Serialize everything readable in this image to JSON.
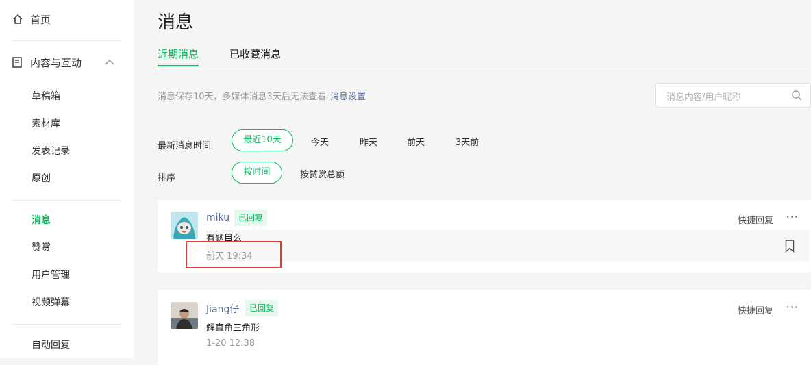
{
  "sidebar": {
    "home": "首页",
    "group": "内容与互动",
    "items": [
      "草稿箱",
      "素材库",
      "发表记录",
      "原创"
    ],
    "items2": [
      "消息",
      "赞赏",
      "用户管理",
      "视频弹幕"
    ],
    "items3": [
      "自动回复"
    ]
  },
  "main": {
    "title": "消息",
    "tabs": [
      "近期消息",
      "已收藏消息"
    ],
    "notice": "消息保存10天，多媒体消息3天后无法查看",
    "notice_link": "消息设置",
    "search_placeholder": "消息内容/用户昵称",
    "time_filter": {
      "label": "最新消息时间",
      "options": [
        "最近10天",
        "今天",
        "昨天",
        "前天",
        "3天前"
      ],
      "selected": "最近10天"
    },
    "sort_filter": {
      "label": "排序",
      "options": [
        "按时间",
        "按赞赏总额"
      ],
      "selected": "按时间"
    },
    "messages": [
      {
        "user": "miku",
        "status": "已回复",
        "content": "有题目么",
        "time": "前天 19:34",
        "quick_reply": "快捷回复",
        "more": "···"
      },
      {
        "user": "Jiang仔",
        "status": "已回复",
        "content": "解直角三角形",
        "time": "1-20 12:38",
        "quick_reply": "快捷回复",
        "more": "···"
      }
    ]
  },
  "colors": {
    "accent": "#07c160",
    "link": "#576b95",
    "highlight": "#e03c3c"
  }
}
